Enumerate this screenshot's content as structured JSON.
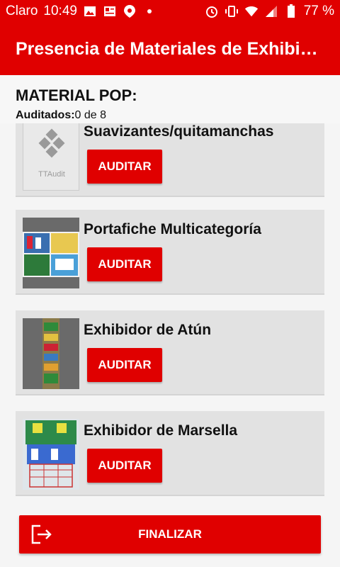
{
  "status_bar": {
    "carrier": "Claro",
    "time": "10:49",
    "battery": "77 %",
    "left_icons": [
      "image-icon",
      "news-icon",
      "location-pin-icon",
      "dot-icon"
    ],
    "right_icons": [
      "alarm-icon",
      "vibrate-icon",
      "wifi-icon",
      "signal-icon",
      "battery-icon"
    ]
  },
  "app_bar": {
    "title": "Presencia de Materiales de Exhibición"
  },
  "header": {
    "section_title": "MATERIAL POP:",
    "audited_label": "Auditados:",
    "audited_value": "0 de 8"
  },
  "items": [
    {
      "title": "Suavizantes/quitamanchas",
      "button": "AUDITAR",
      "thumb": "ttaudit-logo"
    },
    {
      "title": "Portafiche Multicategoría",
      "button": "AUDITAR",
      "thumb": "poster-photo"
    },
    {
      "title": "Exhibidor de Atún",
      "button": "AUDITAR",
      "thumb": "display-rack-photo"
    },
    {
      "title": "Exhibidor de Marsella",
      "button": "AUDITAR",
      "thumb": "marsella-display-photo"
    }
  ],
  "footer": {
    "button_label": "FINALIZAR",
    "icon": "exit-icon"
  },
  "colors": {
    "primary": "#e00000",
    "card_bg": "#e2e2e2",
    "page_bg": "#f5f5f5"
  },
  "thumb_text": {
    "ttaudit": "TTAudit"
  }
}
